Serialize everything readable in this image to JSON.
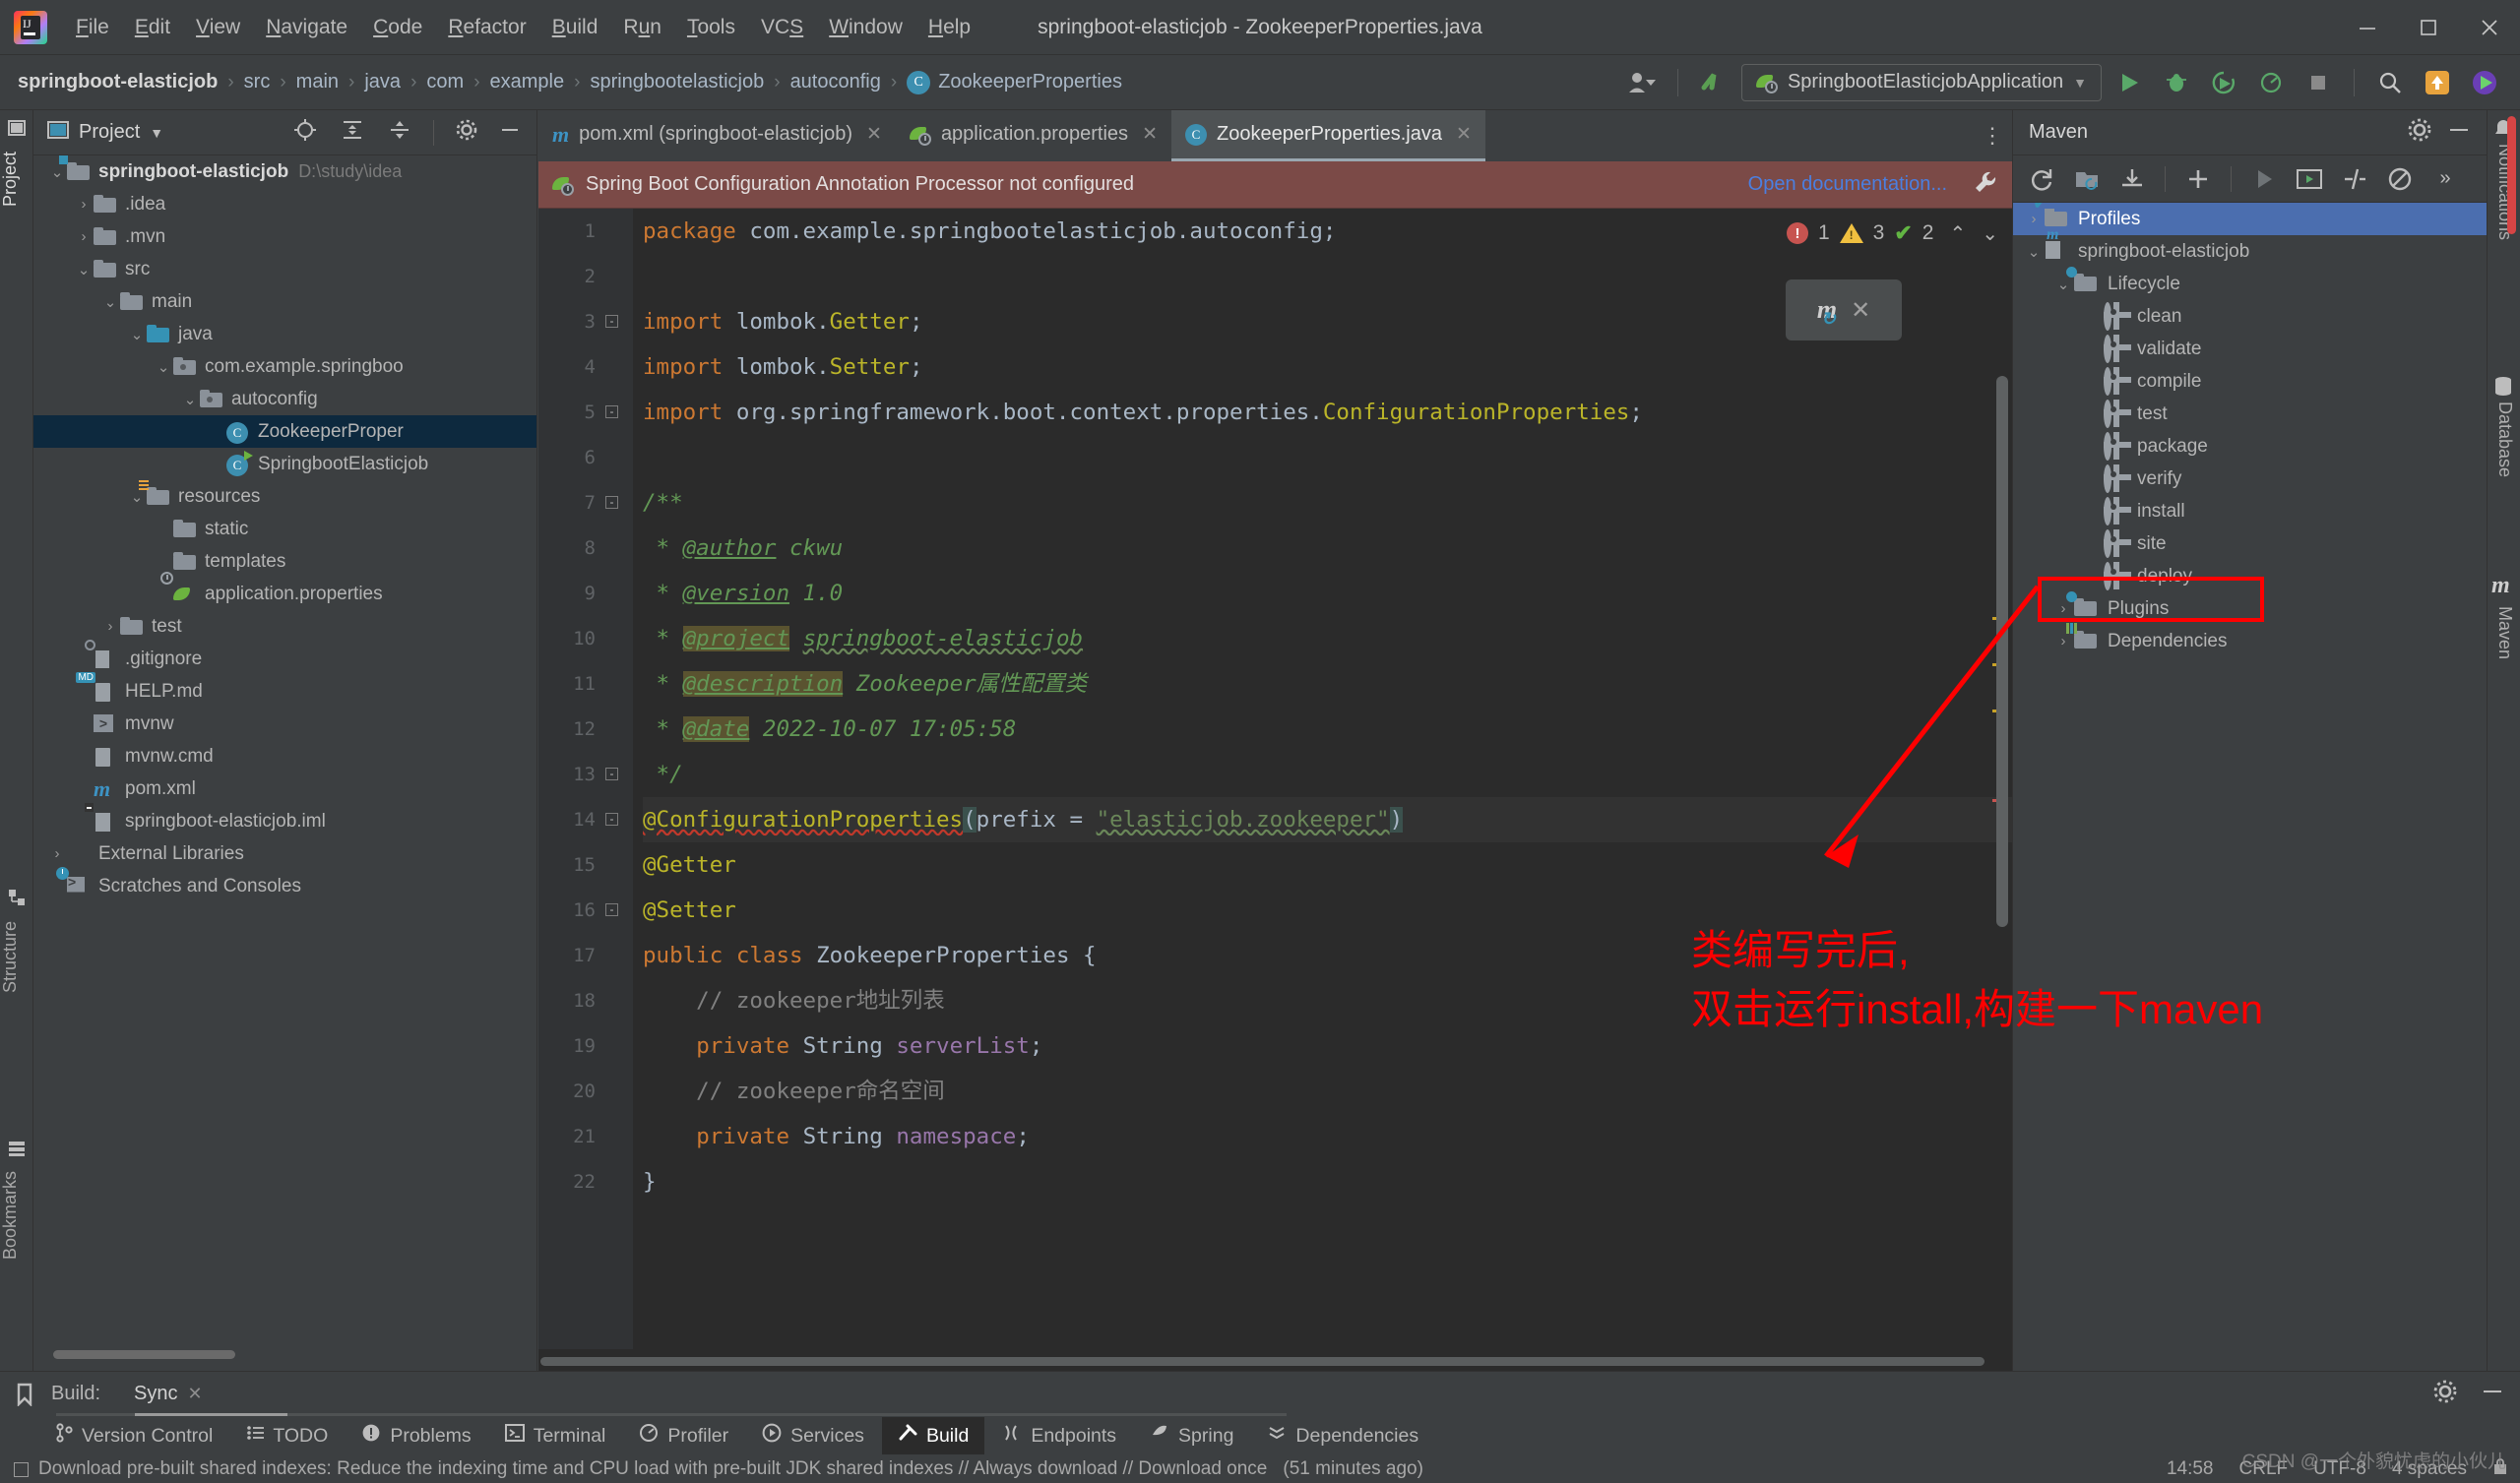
{
  "window": {
    "title": "springboot-elasticjob - ZookeeperProperties.java",
    "minimize": "—",
    "maximize": "□",
    "close": "✕"
  },
  "menu": [
    {
      "label": "File",
      "mnemonic": "F"
    },
    {
      "label": "Edit",
      "mnemonic": "E"
    },
    {
      "label": "View",
      "mnemonic": "V"
    },
    {
      "label": "Navigate",
      "mnemonic": "N"
    },
    {
      "label": "Code",
      "mnemonic": "C"
    },
    {
      "label": "Refactor",
      "mnemonic": "R"
    },
    {
      "label": "Build",
      "mnemonic": "B"
    },
    {
      "label": "Run",
      "mnemonic": "u"
    },
    {
      "label": "Tools",
      "mnemonic": "T"
    },
    {
      "label": "VCS",
      "mnemonic": "S"
    },
    {
      "label": "Window",
      "mnemonic": "W"
    },
    {
      "label": "Help",
      "mnemonic": "H"
    }
  ],
  "breadcrumbs": [
    "springboot-elasticjob",
    "src",
    "main",
    "java",
    "com",
    "example",
    "springbootelasticjob",
    "autoconfig",
    "ZookeeperProperties"
  ],
  "run_config": {
    "name": "SpringbootElasticjobApplication"
  },
  "left_strip": [
    {
      "label": "Project",
      "icon": "project-icon"
    },
    {
      "label": "Structure",
      "icon": "structure-icon"
    },
    {
      "label": "Bookmarks",
      "icon": "bookmarks-icon"
    }
  ],
  "right_strip": [
    {
      "label": "Notifications",
      "icon": "bell-icon"
    },
    {
      "label": "Database",
      "icon": "database-icon"
    },
    {
      "label": "Maven",
      "icon": "maven-icon"
    }
  ],
  "project_panel": {
    "title": "Project",
    "root": {
      "label": "springboot-elasticjob",
      "path": "D:\\study\\idea"
    },
    "items": [
      {
        "label": "springboot-elasticjob",
        "path": "D:\\study\\idea",
        "depth": 0,
        "arrow": "down",
        "icon": "module-folder-icon",
        "bold": true
      },
      {
        "label": ".idea",
        "depth": 1,
        "arrow": "right",
        "icon": "folder-icon"
      },
      {
        "label": ".mvn",
        "depth": 1,
        "arrow": "right",
        "icon": "folder-icon"
      },
      {
        "label": "src",
        "depth": 1,
        "arrow": "down",
        "icon": "folder-icon"
      },
      {
        "label": "main",
        "depth": 2,
        "arrow": "down",
        "icon": "folder-icon"
      },
      {
        "label": "java",
        "depth": 3,
        "arrow": "down",
        "icon": "source-folder-icon"
      },
      {
        "label": "com.example.springboo",
        "depth": 4,
        "arrow": "down",
        "icon": "package-icon"
      },
      {
        "label": "autoconfig",
        "depth": 5,
        "arrow": "down",
        "icon": "package-icon"
      },
      {
        "label": "ZookeeperProper",
        "depth": 6,
        "arrow": "none",
        "icon": "java-class-icon",
        "selected": true
      },
      {
        "label": "SpringbootElasticjob",
        "depth": 6,
        "arrow": "none",
        "icon": "spring-boot-class-icon"
      },
      {
        "label": "resources",
        "depth": 3,
        "arrow": "down",
        "icon": "resources-folder-icon"
      },
      {
        "label": "static",
        "depth": 4,
        "arrow": "none",
        "icon": "folder-icon"
      },
      {
        "label": "templates",
        "depth": 4,
        "arrow": "none",
        "icon": "folder-icon"
      },
      {
        "label": "application.properties",
        "depth": 4,
        "arrow": "none",
        "icon": "spring-properties-icon"
      },
      {
        "label": "test",
        "depth": 2,
        "arrow": "right",
        "icon": "folder-icon"
      },
      {
        "label": ".gitignore",
        "depth": 1,
        "arrow": "none",
        "icon": "gitignore-icon"
      },
      {
        "label": "HELP.md",
        "depth": 1,
        "arrow": "none",
        "icon": "markdown-icon"
      },
      {
        "label": "mvnw",
        "depth": 1,
        "arrow": "none",
        "icon": "executable-icon"
      },
      {
        "label": "mvnw.cmd",
        "depth": 1,
        "arrow": "none",
        "icon": "cmd-file-icon"
      },
      {
        "label": "pom.xml",
        "depth": 1,
        "arrow": "none",
        "icon": "maven-pom-icon"
      },
      {
        "label": "springboot-elasticjob.iml",
        "depth": 1,
        "arrow": "none",
        "icon": "iml-file-icon"
      },
      {
        "label": "External Libraries",
        "depth": 0,
        "arrow": "right",
        "icon": "libraries-icon"
      },
      {
        "label": "Scratches and Consoles",
        "depth": 0,
        "arrow": "none",
        "icon": "scratches-icon"
      }
    ]
  },
  "editor": {
    "tabs": [
      {
        "label": "pom.xml (springboot-elasticjob)",
        "icon": "maven-pom-icon",
        "active": false
      },
      {
        "label": "application.properties",
        "icon": "spring-properties-icon",
        "active": false
      },
      {
        "label": "ZookeeperProperties.java",
        "icon": "java-class-icon",
        "active": true
      }
    ],
    "notification": {
      "text": "Spring Boot Configuration Annotation Processor not configured",
      "action": "Open documentation...",
      "icon": "spring-icon"
    },
    "inspections": {
      "errors": "1",
      "warnings": "3",
      "checks": "2"
    },
    "maven_popup": {
      "icon": "maven-reload-icon",
      "close": "✕"
    },
    "lines": [
      {
        "n": 1,
        "text": "package com.example.springbootelasticjob.autoconfig;"
      },
      {
        "n": 2,
        "text": ""
      },
      {
        "n": 3,
        "text": "import lombok.Getter;"
      },
      {
        "n": 4,
        "text": "import lombok.Setter;"
      },
      {
        "n": 5,
        "text": "import org.springframework.boot.context.properties.ConfigurationProperties;"
      },
      {
        "n": 6,
        "text": ""
      },
      {
        "n": 7,
        "text": "/**"
      },
      {
        "n": 8,
        "text": " * @author ckwu"
      },
      {
        "n": 9,
        "text": " * @version 1.0"
      },
      {
        "n": 10,
        "text": " * @project springboot-elasticjob"
      },
      {
        "n": 11,
        "text": " * @description Zookeeper属性配置类"
      },
      {
        "n": 12,
        "text": " * @date 2022-10-07 17:05:58"
      },
      {
        "n": 13,
        "text": " */"
      },
      {
        "n": 14,
        "text": "@ConfigurationProperties(prefix = \"elasticjob.zookeeper\")"
      },
      {
        "n": 15,
        "text": "@Getter"
      },
      {
        "n": 16,
        "text": "@Setter"
      },
      {
        "n": 17,
        "text": "public class ZookeeperProperties {"
      },
      {
        "n": 18,
        "text": "    // zookeeper地址列表"
      },
      {
        "n": 19,
        "text": "    private String serverList;"
      },
      {
        "n": 20,
        "text": "    // zookeeper命名空间"
      },
      {
        "n": 21,
        "text": "    private String namespace;"
      },
      {
        "n": 22,
        "text": "}"
      }
    ]
  },
  "maven_panel": {
    "title": "Maven",
    "toolbar": [
      "reload-icon",
      "add-module-icon",
      "download-sources-icon",
      "plus-icon",
      "run-icon",
      "execute-goal-icon",
      "toggle-skip-tests-icon",
      "toggle-offline-icon",
      "more-icon"
    ],
    "tree": [
      {
        "label": "Profiles",
        "depth": 0,
        "arrow": "right",
        "icon": "profiles-icon",
        "selected": true
      },
      {
        "label": "springboot-elasticjob",
        "depth": 0,
        "arrow": "down",
        "icon": "maven-project-icon"
      },
      {
        "label": "Lifecycle",
        "depth": 1,
        "arrow": "down",
        "icon": "lifecycle-folder-icon"
      },
      {
        "label": "clean",
        "depth": 2,
        "arrow": "none",
        "icon": "goal-gear-icon"
      },
      {
        "label": "validate",
        "depth": 2,
        "arrow": "none",
        "icon": "goal-gear-icon"
      },
      {
        "label": "compile",
        "depth": 2,
        "arrow": "none",
        "icon": "goal-gear-icon"
      },
      {
        "label": "test",
        "depth": 2,
        "arrow": "none",
        "icon": "goal-gear-icon"
      },
      {
        "label": "package",
        "depth": 2,
        "arrow": "none",
        "icon": "goal-gear-icon"
      },
      {
        "label": "verify",
        "depth": 2,
        "arrow": "none",
        "icon": "goal-gear-icon"
      },
      {
        "label": "install",
        "depth": 2,
        "arrow": "none",
        "icon": "goal-gear-icon",
        "highlighted": true
      },
      {
        "label": "site",
        "depth": 2,
        "arrow": "none",
        "icon": "goal-gear-icon"
      },
      {
        "label": "deploy",
        "depth": 2,
        "arrow": "none",
        "icon": "goal-gear-icon"
      },
      {
        "label": "Plugins",
        "depth": 1,
        "arrow": "right",
        "icon": "plugins-folder-icon"
      },
      {
        "label": "Dependencies",
        "depth": 1,
        "arrow": "right",
        "icon": "dependencies-folder-icon"
      }
    ]
  },
  "annotation": {
    "line1": "类编写完后,",
    "line2": "双击运行install,构建一下maven",
    "color": "#ff0000"
  },
  "bottom": {
    "build_label": "Build:",
    "sync_tab": "Sync",
    "sync_close": "✕",
    "tool_windows": [
      {
        "label": "Version Control",
        "icon": "branch-icon",
        "active": false
      },
      {
        "label": "TODO",
        "icon": "todo-icon",
        "active": false
      },
      {
        "label": "Problems",
        "icon": "problems-icon",
        "active": false
      },
      {
        "label": "Terminal",
        "icon": "terminal-icon",
        "active": false
      },
      {
        "label": "Profiler",
        "icon": "profiler-icon",
        "active": false
      },
      {
        "label": "Services",
        "icon": "services-icon",
        "active": false
      },
      {
        "label": "Build",
        "icon": "build-hammer-icon",
        "active": true
      },
      {
        "label": "Endpoints",
        "icon": "endpoints-icon",
        "active": false
      },
      {
        "label": "Spring",
        "icon": "spring-icon",
        "active": false
      },
      {
        "label": "Dependencies",
        "icon": "dependencies-icon",
        "active": false
      }
    ],
    "status_message": "Download pre-built shared indexes: Reduce the indexing time and CPU load with pre-built JDK shared indexes // Always download // Download once",
    "status_time_ago": "(51 minutes ago)",
    "status_right": [
      "14:58",
      "CRLF",
      "UTF-8",
      "4 spaces"
    ]
  },
  "watermark": "CSDN @一个外貌忧虑的小伙儿"
}
